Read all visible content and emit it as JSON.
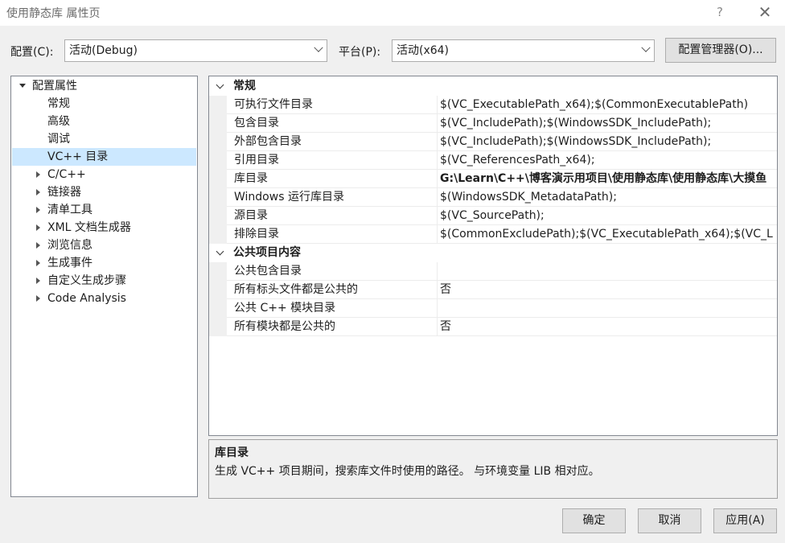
{
  "window": {
    "title": "使用静态库 属性页",
    "help_label": "?",
    "close_label": "✕"
  },
  "toolbar": {
    "config_label": "配置(C):",
    "config_value": "活动(Debug)",
    "platform_label": "平台(P):",
    "platform_value": "活动(x64)",
    "config_manager_label": "配置管理器(O)..."
  },
  "tree": {
    "root": "配置属性",
    "items": [
      {
        "label": "常规",
        "expandable": false,
        "selected": false
      },
      {
        "label": "高级",
        "expandable": false,
        "selected": false
      },
      {
        "label": "调试",
        "expandable": false,
        "selected": false
      },
      {
        "label": "VC++ 目录",
        "expandable": false,
        "selected": true
      },
      {
        "label": "C/C++",
        "expandable": true,
        "selected": false
      },
      {
        "label": "链接器",
        "expandable": true,
        "selected": false
      },
      {
        "label": "清单工具",
        "expandable": true,
        "selected": false
      },
      {
        "label": "XML 文档生成器",
        "expandable": true,
        "selected": false
      },
      {
        "label": "浏览信息",
        "expandable": true,
        "selected": false
      },
      {
        "label": "生成事件",
        "expandable": true,
        "selected": false
      },
      {
        "label": "自定义生成步骤",
        "expandable": true,
        "selected": false
      },
      {
        "label": "Code Analysis",
        "expandable": true,
        "selected": false
      }
    ]
  },
  "grid": {
    "categories": [
      {
        "label": "常规",
        "properties": [
          {
            "name": "可执行文件目录",
            "value": "$(VC_ExecutablePath_x64);$(CommonExecutablePath)",
            "bold": false
          },
          {
            "name": "包含目录",
            "value": "$(VC_IncludePath);$(WindowsSDK_IncludePath);",
            "bold": false
          },
          {
            "name": "外部包含目录",
            "value": "$(VC_IncludePath);$(WindowsSDK_IncludePath);",
            "bold": false
          },
          {
            "name": "引用目录",
            "value": "$(VC_ReferencesPath_x64);",
            "bold": false
          },
          {
            "name": "库目录",
            "value": "G:\\Learn\\C++\\博客演示用项目\\使用静态库\\使用静态库\\大摸鱼",
            "bold": true
          },
          {
            "name": "Windows 运行库目录",
            "value": "$(WindowsSDK_MetadataPath);",
            "bold": false
          },
          {
            "name": "源目录",
            "value": "$(VC_SourcePath);",
            "bold": false
          },
          {
            "name": "排除目录",
            "value": "$(CommonExcludePath);$(VC_ExecutablePath_x64);$(VC_L",
            "bold": false
          }
        ]
      },
      {
        "label": "公共项目内容",
        "properties": [
          {
            "name": "公共包含目录",
            "value": "",
            "bold": false
          },
          {
            "name": "所有标头文件都是公共的",
            "value": "否",
            "bold": false
          },
          {
            "name": "公共 C++ 模块目录",
            "value": "",
            "bold": false
          },
          {
            "name": "所有模块都是公共的",
            "value": "否",
            "bold": false
          }
        ]
      }
    ]
  },
  "description": {
    "title": "库目录",
    "text": "生成 VC++ 项目期间，搜索库文件时使用的路径。 与环境变量 LIB 相对应。"
  },
  "buttons": {
    "ok": "确定",
    "cancel": "取消",
    "apply": "应用(A)"
  }
}
